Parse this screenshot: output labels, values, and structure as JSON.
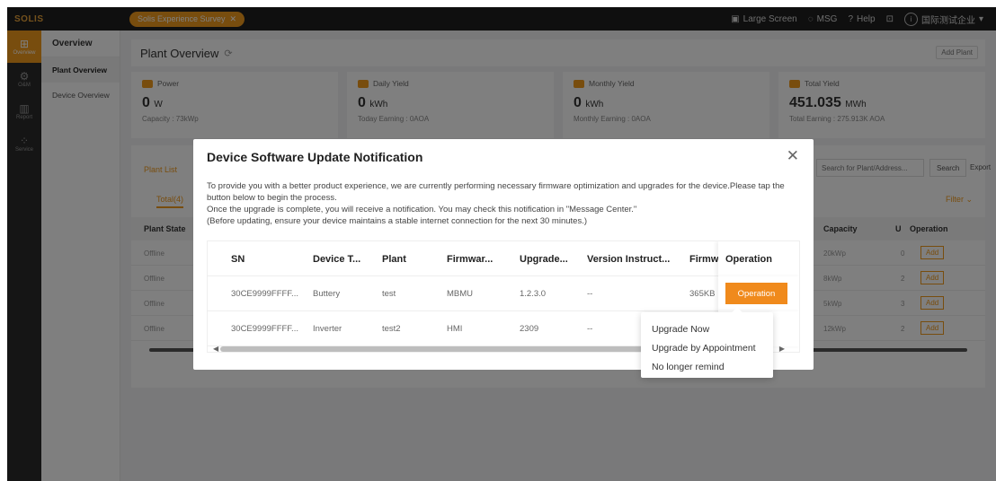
{
  "topbar": {
    "logo": "SOLIS",
    "notice": "Solis Experience Survey",
    "large_screen": "Large Screen",
    "msg": "MSG",
    "help": "Help",
    "user": "国际测试企业"
  },
  "rail": {
    "items": [
      {
        "label": "Overview",
        "icon": "grid-icon"
      },
      {
        "label": "O&M",
        "icon": "wrench-icon"
      },
      {
        "label": "Report",
        "icon": "report-icon"
      },
      {
        "label": "Service",
        "icon": "service-icon"
      }
    ]
  },
  "submenu": {
    "title": "Overview",
    "items": [
      "Plant Overview",
      "Device Overview"
    ]
  },
  "page": {
    "title": "Plant Overview",
    "add_plant": "Add Plant"
  },
  "stats": [
    {
      "label": "Power",
      "value": "0",
      "unit": "W",
      "sub": "Capacity : 73kWp"
    },
    {
      "label": "Daily Yield",
      "value": "0",
      "unit": "kWh",
      "sub": "Today Earning : 0AOA"
    },
    {
      "label": "Monthly Yield",
      "value": "0",
      "unit": "kWh",
      "sub": "Monthly Earning : 0AOA"
    },
    {
      "label": "Total Yield",
      "value": "451.035",
      "unit": "MWh",
      "sub": "Total Earning : 275.913K AOA"
    }
  ],
  "plant_list": {
    "tab": "Plant List",
    "subtab": "Total(4)",
    "search_placeholder": "Search for Plant/Address...",
    "search_btn": "Search",
    "export_btn": "Export",
    "filter": "Filter",
    "headers": {
      "state": "Plant State",
      "capacity": "Capacity",
      "u": "U",
      "operation": "Operation"
    },
    "rows": [
      {
        "state": "Offline",
        "capacity": "20kWp",
        "u": "0",
        "op": "Add"
      },
      {
        "state": "Offline",
        "capacity": "8kWp",
        "u": "2",
        "op": "Add"
      },
      {
        "state": "Offline",
        "capacity": "5kWp",
        "u": "3",
        "op": "Add"
      },
      {
        "state": "Offline",
        "capacity": "12kWp",
        "u": "2",
        "op": "Add"
      }
    ]
  },
  "modal": {
    "title": "Device Software Update Notification",
    "line1": "To provide you with a better product experience, we are currently performing necessary firmware optimization and upgrades for the device.Please tap the button below to begin the process.",
    "line2": "Once the upgrade is complete, you will receive a notification. You may check this notification in \"Message Center.\"",
    "line3": "(Before updating, ensure your device maintains a stable internet connection for the next 30 minutes.)",
    "table": {
      "headers": {
        "sn": "SN",
        "device_type": "Device T...",
        "plant": "Plant",
        "firmware": "Firmwar...",
        "upgrade": "Upgrade...",
        "version": "Version Instruct...",
        "firmware_size": "Firmw",
        "operation": "Operation"
      },
      "rows": [
        {
          "sn": "30CE9999FFFF...",
          "device_type": "Buttery",
          "plant": "test",
          "firmware": "MBMU",
          "upgrade": "1.2.3.0",
          "version": "--",
          "firmware_size": "365KB",
          "operation": "Operation"
        },
        {
          "sn": "30CE9999FFFF...",
          "device_type": "Inverter",
          "plant": "test2",
          "firmware": "HMI",
          "upgrade": "2309",
          "version": "--",
          "firmware_size": ""
        }
      ]
    },
    "dropdown": [
      "Upgrade Now",
      "Upgrade by Appointment",
      "No longer remind"
    ]
  },
  "colors": {
    "accent": "#f08a1c",
    "topbar": "#1f1f1f",
    "rail": "#2b2b2b"
  }
}
